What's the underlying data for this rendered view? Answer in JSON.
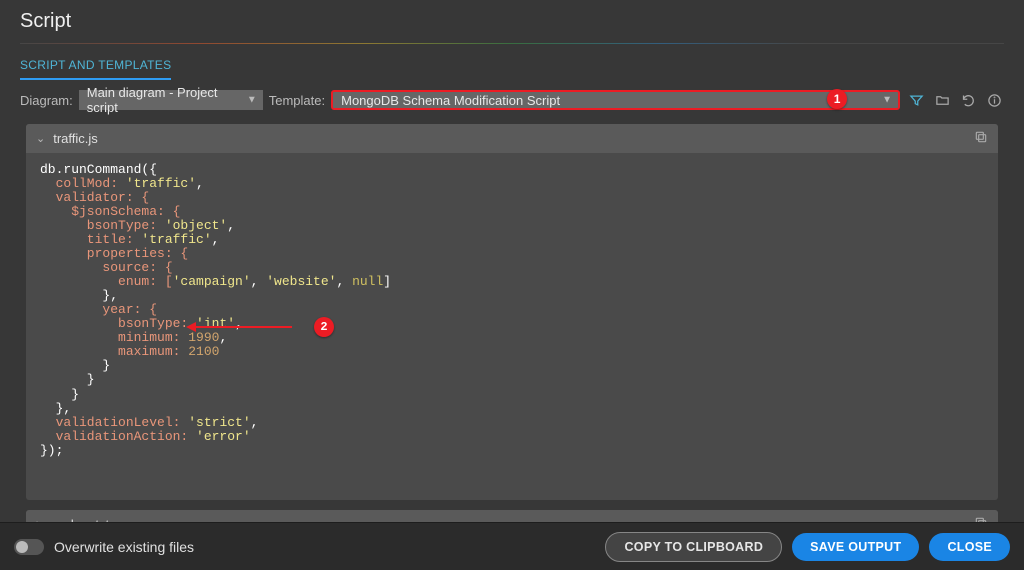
{
  "title": "Script",
  "section_tab": "SCRIPT AND TEMPLATES",
  "labels": {
    "diagram": "Diagram:",
    "template": "Template:"
  },
  "diagram_select": {
    "value": "Main diagram - Project script"
  },
  "template_select": {
    "value": "MongoDB Schema Modification Script"
  },
  "callouts": {
    "one": "1",
    "two": "2"
  },
  "icons": {
    "filter": "filter-icon",
    "folder": "folder-icon",
    "undo": "undo-icon",
    "info": "info-icon",
    "copy": "copy-icon"
  },
  "files": [
    {
      "name": "traffic.js",
      "expanded": true
    },
    {
      "name": "readme.txt",
      "expanded": false
    }
  ],
  "code": {
    "l1a": "db.runCommand({",
    "l2a": "  collMod: ",
    "l2s": "'traffic'",
    "l2b": ",",
    "l3a": "  validator: {",
    "l4a": "    $jsonSchema: {",
    "l5a": "      bsonType: ",
    "l5s": "'object'",
    "l5b": ",",
    "l6a": "      title: ",
    "l6s": "'traffic'",
    "l6b": ",",
    "l7a": "      properties: {",
    "l8a": "        source: {",
    "l9a": "          enum: [",
    "l9s1": "'campaign'",
    "l9c": ", ",
    "l9s2": "'website'",
    "l9c2": ", ",
    "l9n": "null",
    "l9b": "]",
    "l10a": "        },",
    "l11a": "        year: {",
    "l12a": "          bsonType: ",
    "l12s": "'int'",
    "l12b": ",",
    "l13a": "          minimum: ",
    "l13n": "1990",
    "l13b": ",",
    "l14a": "          maximum: ",
    "l14n": "2100",
    "l15a": "        }",
    "l16a": "      }",
    "l17a": "    }",
    "l18a": "  },",
    "l19a": "  validationLevel: ",
    "l19s": "'strict'",
    "l19b": ",",
    "l20a": "  validationAction: ",
    "l20s": "'error'",
    "l21a": "});"
  },
  "footer": {
    "overwrite_label": "Overwrite existing files",
    "copy": "COPY TO CLIPBOARD",
    "save": "SAVE OUTPUT",
    "close": "CLOSE"
  }
}
